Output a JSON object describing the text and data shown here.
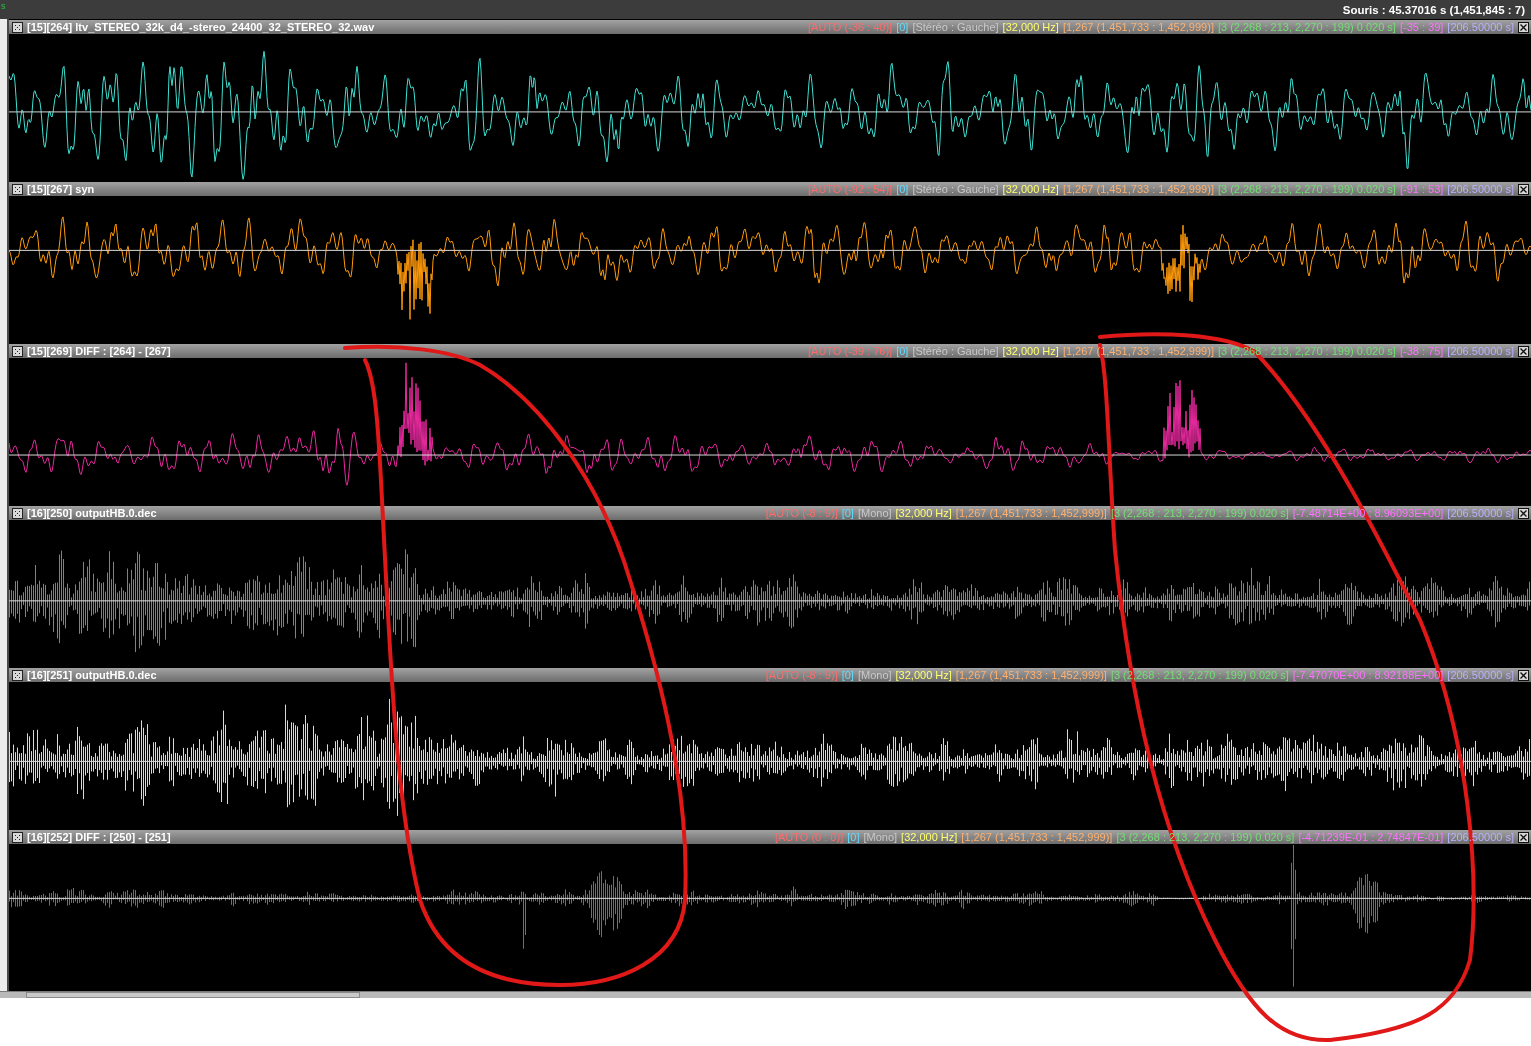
{
  "corner_label": "s",
  "status": "Souris : 45.37016 s (1,451,845 : 7)",
  "tracks": [
    {
      "title": "[15][264] ltv_STEREO_32k_d4_-stereo_24400_32_STEREO_32.wav",
      "color": "#3ee0d2",
      "info": [
        "[AUTO (-36 : 40)]",
        "[0]",
        "[Stéréo : Gauche]",
        "[32,000 Hz]",
        "[1,267 (1,451,733 : 1,452,999)]",
        "[3 (2,268 : 213, 2,270 : 199) 0.020 s]",
        "[-35 : 39]",
        "[206.50000 s]"
      ]
    },
    {
      "title": "[15][267] syn",
      "color": "#ff9a0a",
      "info": [
        "[AUTO (-92 : 54)]",
        "[0]",
        "[Stéréo : Gauche]",
        "[32,000 Hz]",
        "[1,267 (1,451,733 : 1,452,999)]",
        "[3 (2,268 : 213, 2,270 : 199) 0.020 s]",
        "[-91 : 53]",
        "[206.50000 s]"
      ]
    },
    {
      "title": "[15][269] DIFF : [264] - [267]",
      "color": "#e8299e",
      "info": [
        "[AUTO (-39 : 76)]",
        "[0]",
        "[Stéréo : Gauche]",
        "[32,000 Hz]",
        "[1,267 (1,451,733 : 1,452,999)]",
        "[3 (2,268 : 213, 2,270 : 199) 0.020 s]",
        "[-38 : 75]",
        "[206.50000 s]"
      ]
    },
    {
      "title": "[16][250] outputHB.0.dec",
      "color": "#4f82ff",
      "info": [
        "[AUTO (-8 : 9)]",
        "[0]",
        "[Mono]",
        "[32,000 Hz]",
        "[1,267 (1,451,733 : 1,452,999)]",
        "[3 (2,268 : 213, 2,270 : 199) 0.020 s]",
        "[-7.48714E+00 : 8.96093E+00]",
        "[206.50000 s]"
      ]
    },
    {
      "title": "[16][251] outputHB.0.dec",
      "color": "#e8cfe6",
      "info": [
        "[AUTO (-8 : 9)]",
        "[0]",
        "[Mono]",
        "[32,000 Hz]",
        "[1,267 (1,451,733 : 1,452,999)]",
        "[3 (2,268 : 213, 2,270 : 199) 0.020 s]",
        "[-7.47070E+00 : 8.92188E+00]",
        "[206.50000 s]"
      ]
    },
    {
      "title": "[16][252] DIFF : [250] - [251]",
      "color": "#9b3cff",
      "info": [
        "[AUTO (0 : 0)]",
        "[0]",
        "[Mono]",
        "[32,000 Hz]",
        "[1,267 (1,451,733 : 1,452,999)]",
        "[3 (2,268 : 213, 2,270 : 199) 0.020 s]",
        "[-4.71239E-01 : 2.74847E-01]",
        "[206.50000 s]"
      ]
    }
  ]
}
